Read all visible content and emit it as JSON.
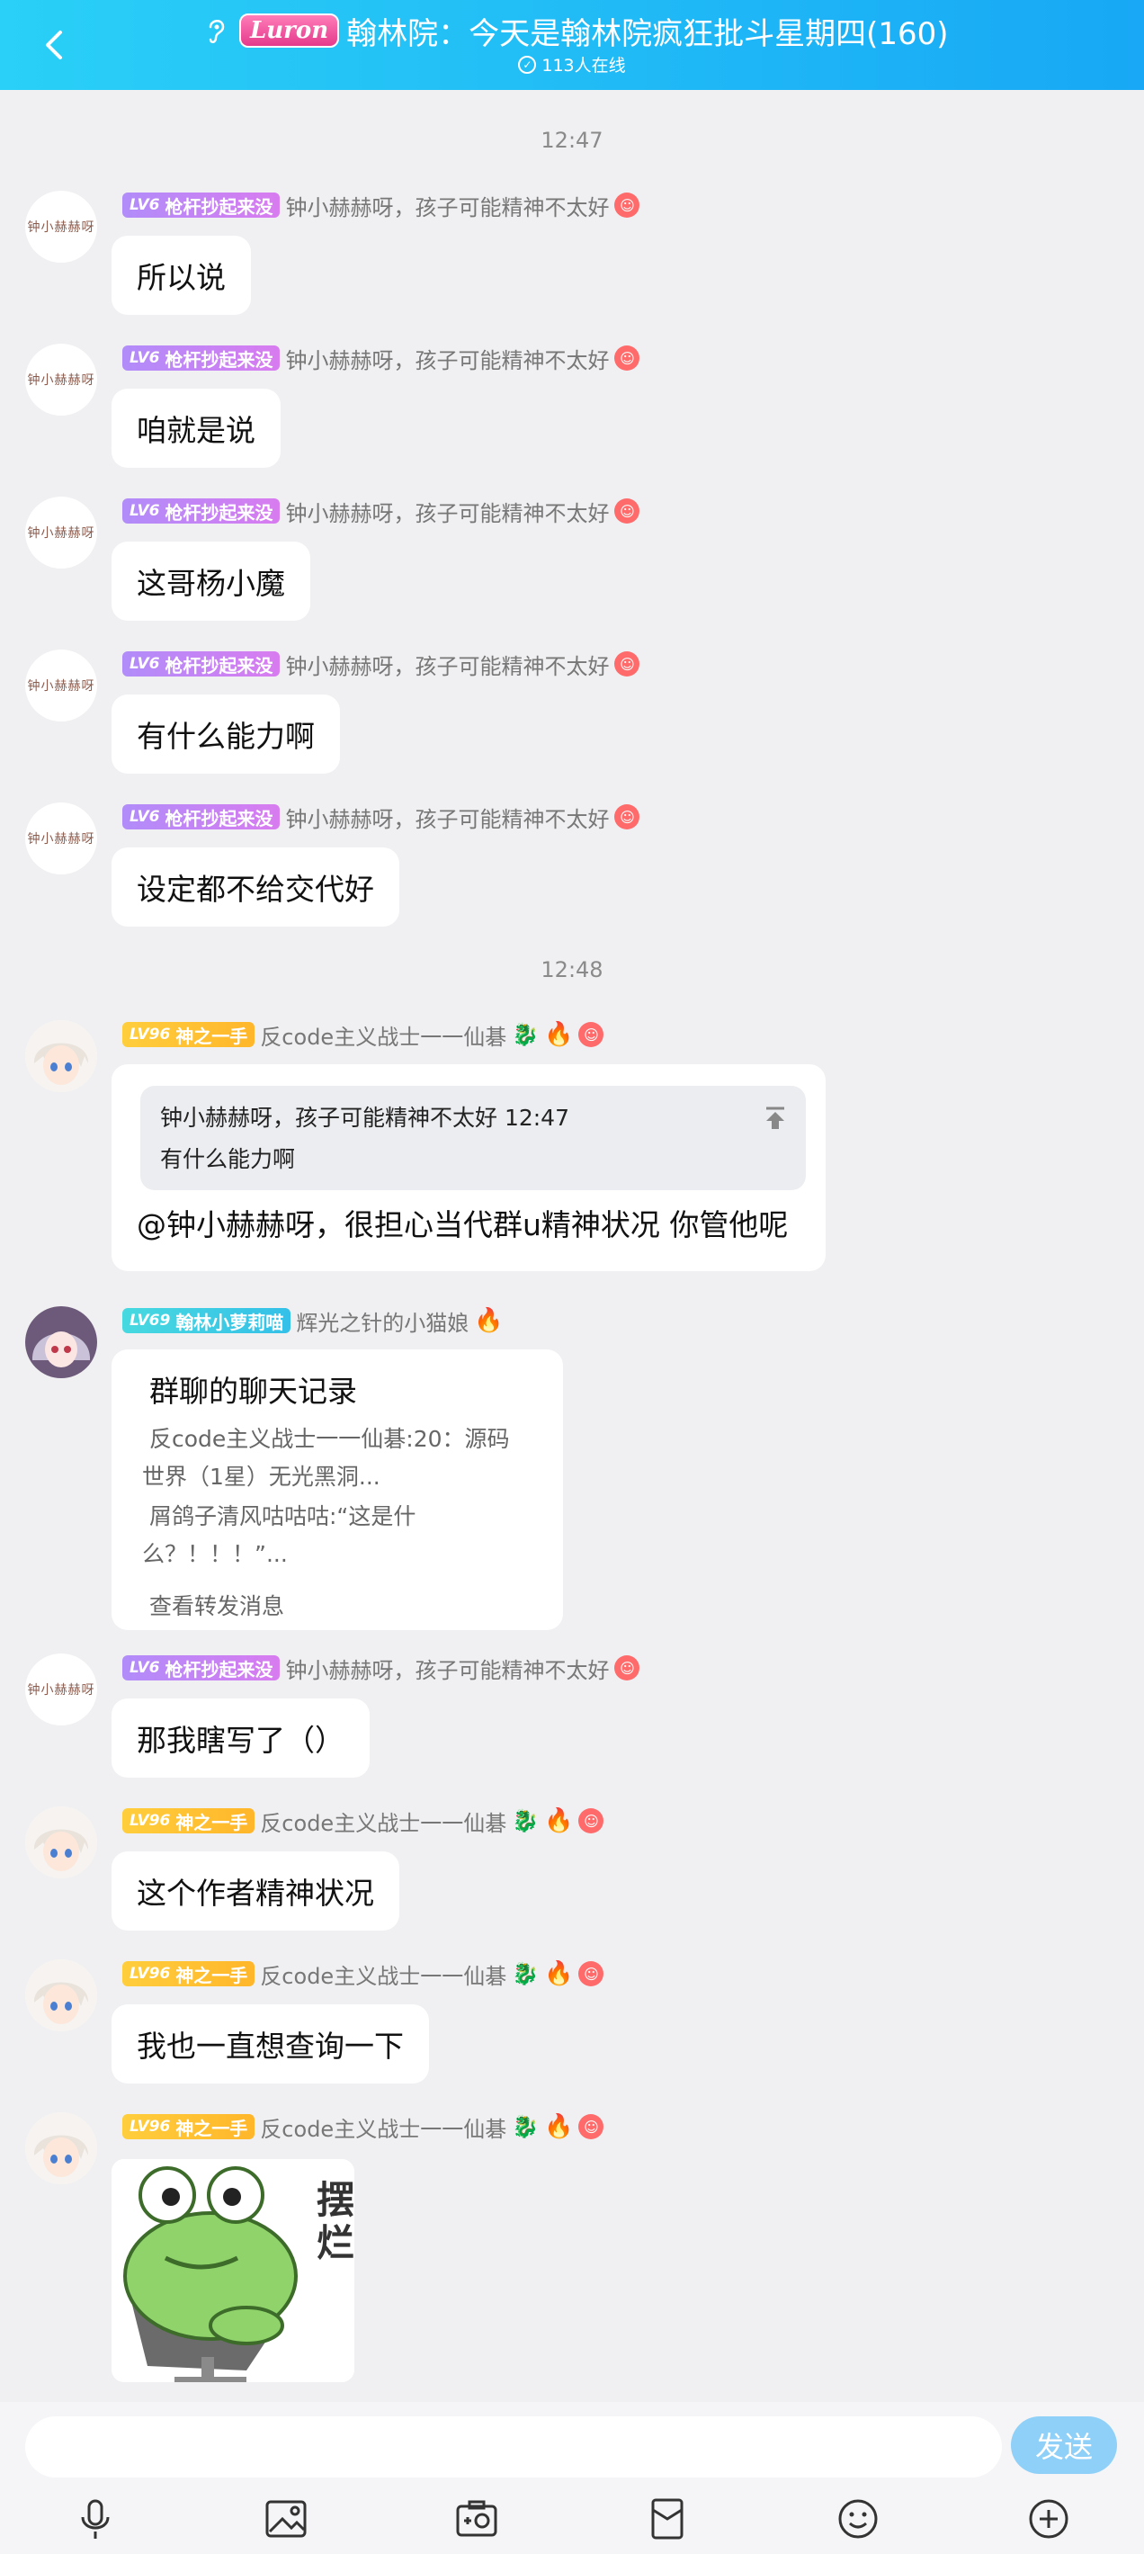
{
  "header": {
    "badge": "Luron",
    "title": "翰林院：今天是翰林院疯狂批斗星期四(160)",
    "online": "113人在线"
  },
  "timestamps": [
    "12:47",
    "12:48"
  ],
  "users": {
    "zhong": {
      "level": "LV6",
      "title": "枪杆抄起来没",
      "name": "钟小赫赫呀，孩子可能精神不太好",
      "avatar_text": "钟小赫赫呀"
    },
    "xian": {
      "level": "LV96",
      "title": "神之一手",
      "name": "反code主义战士一一仙碁"
    },
    "mao": {
      "level": "LV69",
      "title": "翰林小萝莉喵",
      "name": "辉光之针的小猫娘"
    }
  },
  "messages": [
    "所以说",
    "咱就是说",
    "这哥杨小魔",
    "有什么能力啊",
    "设定都不给交代好"
  ],
  "reply": {
    "quote_header": "钟小赫赫呀，孩子可能精神不太好 12:47",
    "quote_text": "有什么能力啊",
    "text": "@钟小赫赫呀，很担心当代群u精神状况 你管他呢"
  },
  "forward": {
    "title": "群聊的聊天记录",
    "line1": "反code主义战士一一仙碁:20：源码",
    "line2": "世界（1星）无光黑洞...",
    "line3": "屑鸽子清风咕咕咕:“这是什",
    "line4": "么？！！！”...",
    "link": "查看转发消息"
  },
  "later_messages": [
    "那我瞎写了（）",
    "这个作者精神状况",
    "我也一直想查询一下"
  ],
  "sticker": {
    "text": "摆烂"
  },
  "input": {
    "placeholder": "",
    "send": "发送"
  },
  "toolbar_icons": [
    "mic-icon",
    "image-icon",
    "camera-icon",
    "red-packet-icon",
    "emoji-icon",
    "plus-icon"
  ]
}
